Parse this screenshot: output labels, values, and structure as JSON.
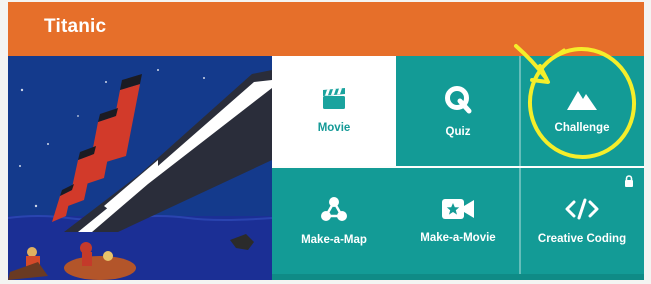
{
  "header": {
    "title": "Titanic"
  },
  "tiles": [
    {
      "label": "Movie",
      "icon": "clapperboard-icon",
      "state": "selected"
    },
    {
      "label": "Quiz",
      "icon": "q-letter-icon"
    },
    {
      "label": "Challenge",
      "icon": "mountain-icon"
    },
    {
      "label": "Make-a-Map",
      "icon": "network-nodes-icon"
    },
    {
      "label": "Make-a-Movie",
      "icon": "movie-camera-icon"
    },
    {
      "label": "Creative Coding",
      "icon": "code-brackets-icon"
    }
  ],
  "locks": [
    {
      "tile": "Creative Coding",
      "icon": "lock-icon"
    }
  ],
  "annotation": {
    "type": "yellow-hand-drawn-circle-and-arrow",
    "target": "Challenge"
  },
  "colors": {
    "header": "#e66f2a",
    "tile_teal": "#139b96",
    "tile_selected_bg": "#ffffff",
    "tile_selected_text": "#159a97",
    "annotation": "#f5ee2a",
    "hero_sky": "#143a8c"
  }
}
